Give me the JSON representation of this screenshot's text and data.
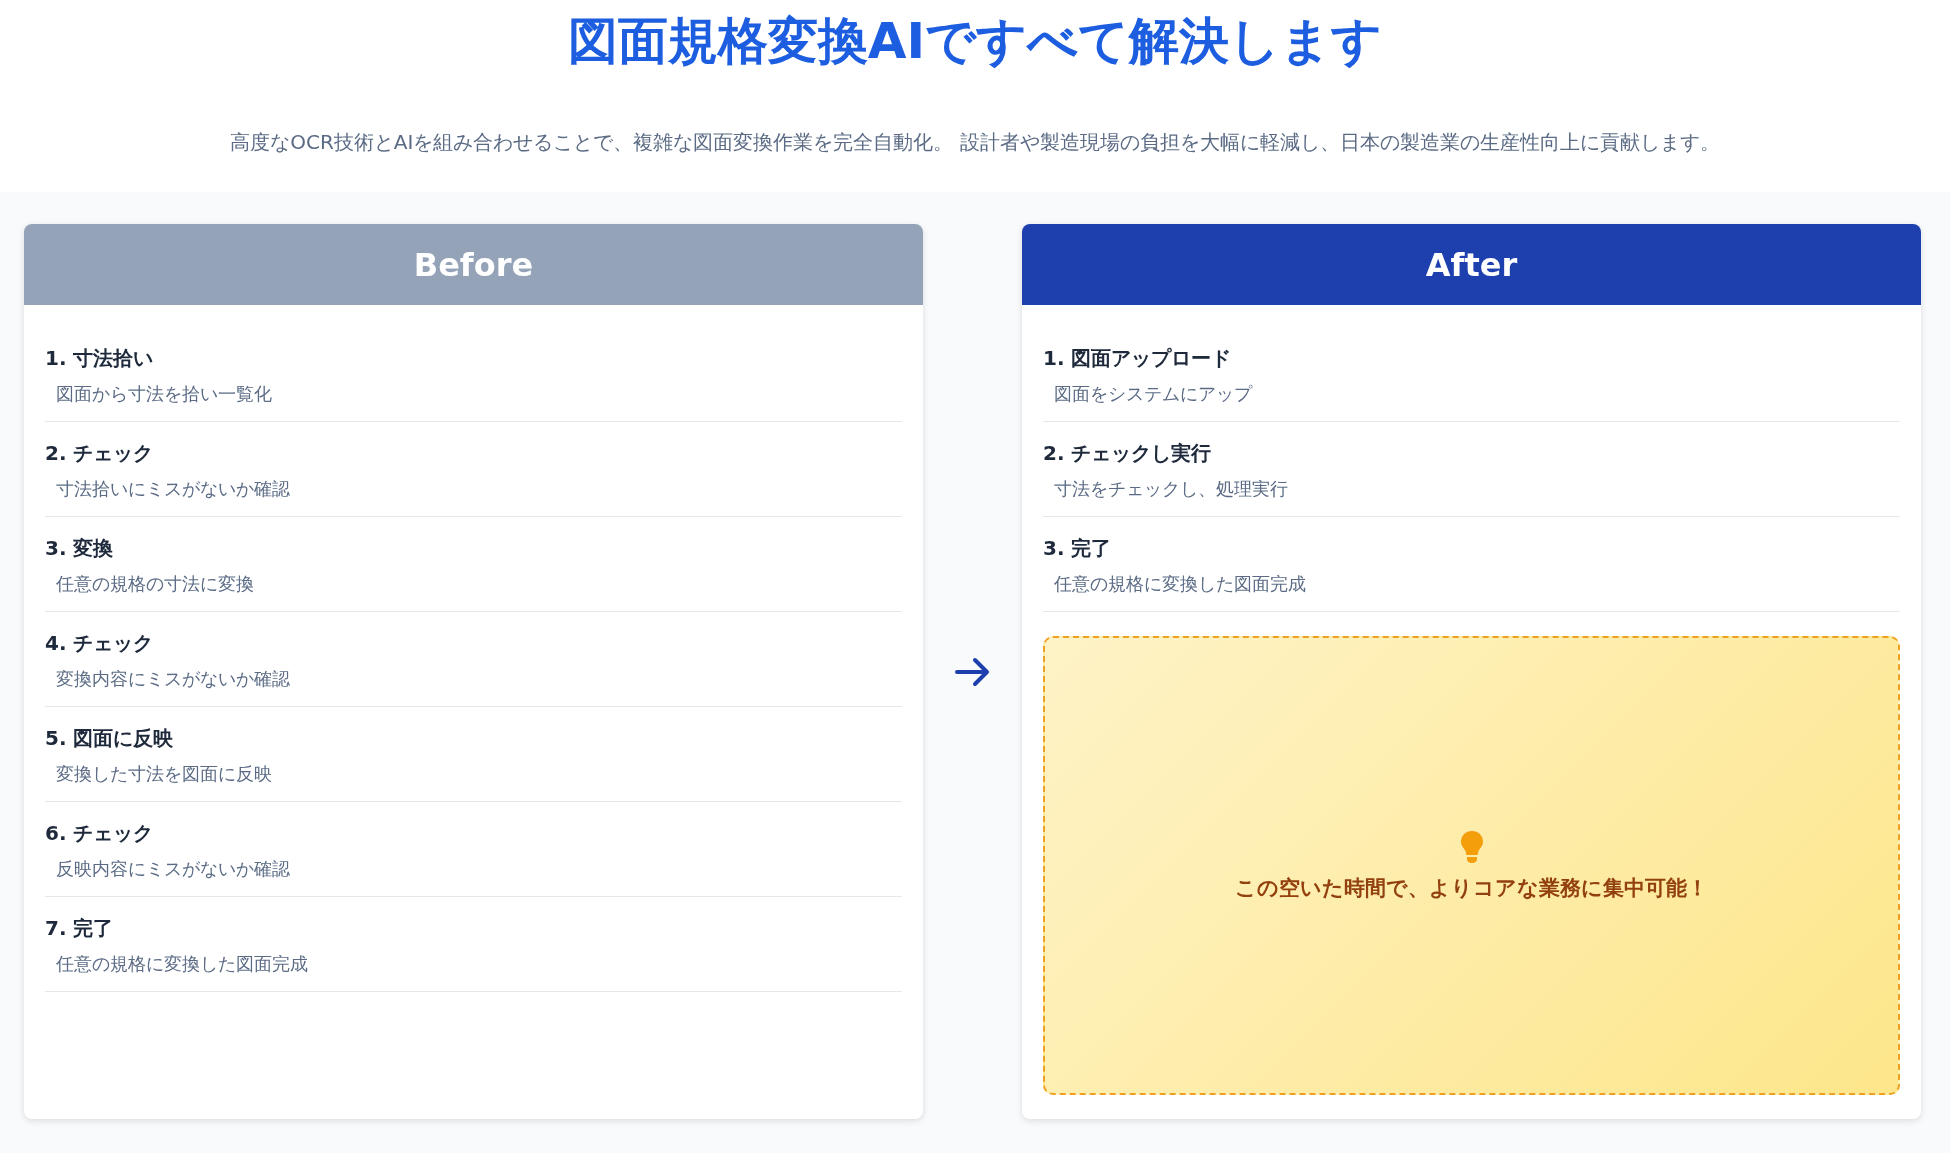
{
  "title": "図面規格変換AIですべて解決します",
  "subtitle": "高度なOCR技術とAIを組み合わせることで、複雑な図面変換作業を完全自動化。 設計者や製造現場の負担を大幅に軽減し、日本の製造業の生産性向上に貢献します。",
  "before": {
    "heading": "Before",
    "steps": [
      {
        "title": "1. 寸法拾い",
        "description": "図面から寸法を拾い一覧化"
      },
      {
        "title": "2. チェック",
        "description": "寸法拾いにミスがないか確認"
      },
      {
        "title": "3. 変換",
        "description": "任意の規格の寸法に変換"
      },
      {
        "title": "4. チェック",
        "description": "変換内容にミスがないか確認"
      },
      {
        "title": "5. 図面に反映",
        "description": "変換した寸法を図面に反映"
      },
      {
        "title": "6. チェック",
        "description": "反映内容にミスがないか確認"
      },
      {
        "title": "7. 完了",
        "description": "任意の規格に変換した図面完成"
      }
    ]
  },
  "after": {
    "heading": "After",
    "steps": [
      {
        "title": "1. 図面アップロード",
        "description": "図面をシステムにアップ"
      },
      {
        "title": "2. チェックし実行",
        "description": "寸法をチェックし、処理実行"
      },
      {
        "title": "3. 完了",
        "description": "任意の規格に変換した図面完成"
      }
    ],
    "callout": {
      "text": "この空いた時間で、よりコアな業務に集中可能！"
    }
  }
}
